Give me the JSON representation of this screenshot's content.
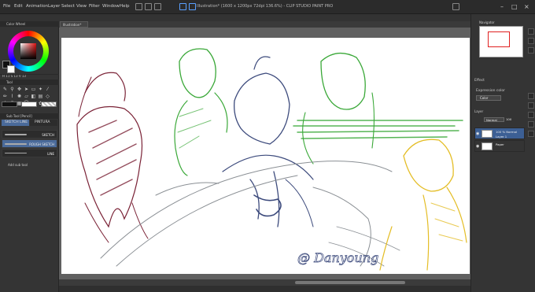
{
  "menu": [
    "File",
    "Edit",
    "Animation",
    "Layer",
    "Select",
    "View",
    "Filter",
    "Window",
    "Help"
  ],
  "title": "Illustration* (1600 x 1200px 72dpi 136.6%) - CLIP STUDIO PAINT PRO",
  "document_tab": "Illustration*",
  "left": {
    "color_wheel_header": "Color Wheel",
    "hsv": "H 11  S 13  V 13",
    "tool_header": "Tool",
    "subtool_header": "Sub Tool [Pencil]",
    "subtool_tabs": [
      "SKETCH LINE",
      "PINTURA"
    ],
    "brushes": [
      "SKETCH",
      "ROUGH SKETCH",
      "LINE"
    ],
    "add_subtool": "Add sub tool"
  },
  "right": {
    "navigator_header": "Navigator",
    "effect_label": "Effect",
    "expression_label": "Expression color",
    "expression_value": "Color",
    "layer_header": "Layer",
    "blend_mode": "Normal",
    "opacity": "100",
    "layers": [
      {
        "line1": "100 % Normal",
        "line2": "Layer 1"
      },
      {
        "line1": "Paper",
        "line2": ""
      }
    ]
  },
  "signature": "@ Danyoung",
  "colors": {
    "maroon": "#7a2236",
    "green": "#3aa838",
    "navy": "#3c4a7c",
    "gray": "#8a8f94",
    "yellow": "#e4bd25"
  }
}
